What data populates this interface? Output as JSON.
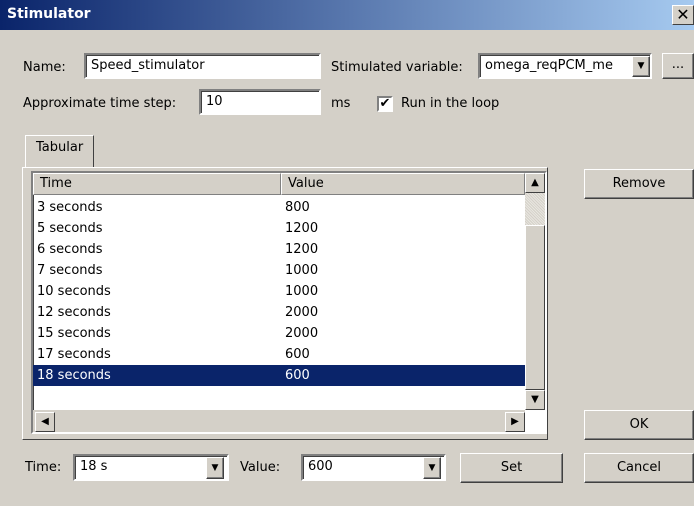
{
  "window": {
    "title": "Stimulator",
    "close_glyph": "✕"
  },
  "name": {
    "label": "Name:",
    "value": "Speed_stimulator"
  },
  "stimulated": {
    "label": "Stimulated variable:",
    "value": "omega_reqPCM_me",
    "browse_label": "..."
  },
  "timestep": {
    "label": "Approximate time step:",
    "value": "10",
    "unit": "ms"
  },
  "run_loop": {
    "label": "Run in the loop",
    "checked": true
  },
  "tabs": [
    {
      "label": "Tabular"
    }
  ],
  "table": {
    "columns": [
      "Time",
      "Value"
    ],
    "rows": [
      {
        "time": "3 seconds",
        "value": "800"
      },
      {
        "time": "5 seconds",
        "value": "1200"
      },
      {
        "time": "6 seconds",
        "value": "1200"
      },
      {
        "time": "7 seconds",
        "value": "1000"
      },
      {
        "time": "10 seconds",
        "value": "1000"
      },
      {
        "time": "12 seconds",
        "value": "2000"
      },
      {
        "time": "15 seconds",
        "value": "2000"
      },
      {
        "time": "17 seconds",
        "value": "600"
      },
      {
        "time": "18 seconds",
        "value": "600"
      }
    ],
    "selected_index": 8
  },
  "buttons": {
    "remove": "Remove",
    "ok": "OK",
    "cancel": "Cancel",
    "set": "Set"
  },
  "edit": {
    "time_label": "Time:",
    "time_value": "18 s",
    "value_label": "Value:",
    "value_value": "600"
  },
  "icons": {
    "dropdown": "▼",
    "scroll_up": "▲",
    "scroll_down": "▼",
    "scroll_left": "◀",
    "scroll_right": "▶",
    "check": "✔"
  },
  "colors": {
    "title_start": "#0a246a",
    "title_end": "#a6caf0",
    "selection": "#0a246a",
    "face": "#d4d0c8"
  }
}
